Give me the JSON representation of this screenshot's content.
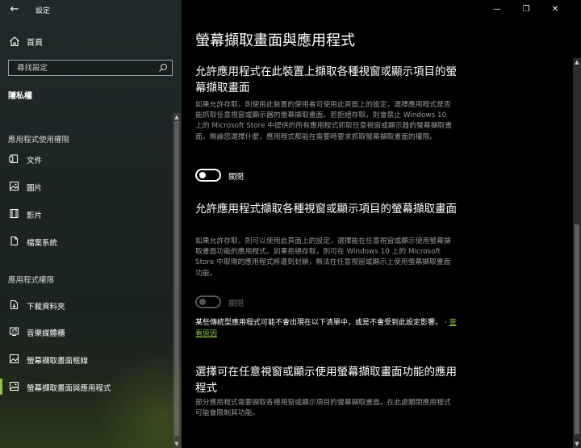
{
  "window": {
    "title": "設定",
    "back_glyph": "←",
    "minimize_glyph": "—",
    "restore_glyph": "❐",
    "close_glyph": "✕"
  },
  "sidebar": {
    "home_label": "首頁",
    "search_placeholder": "尋找設定",
    "privacy_heading": "隱私權",
    "group_app_permissions_top": "應用程式使用權限",
    "group_app_permissions": "應用程式權限",
    "items_top": [
      {
        "label": "文件",
        "icon": "document-icon"
      },
      {
        "label": "圖片",
        "icon": "image-icon"
      },
      {
        "label": "影片",
        "icon": "film-icon"
      },
      {
        "label": "檔案系統",
        "icon": "file-icon"
      }
    ],
    "items_bottom": [
      {
        "label": "下載資料夾",
        "icon": "download-folder-icon"
      },
      {
        "label": "音樂媒體櫃",
        "icon": "music-library-icon"
      },
      {
        "label": "螢幕擷取畫面框線",
        "icon": "screenshot-border-icon"
      },
      {
        "label": "螢幕擷取畫面與應用程式",
        "icon": "screenshot-app-icon",
        "active": true
      }
    ],
    "accent_color": "#8cc63e"
  },
  "main": {
    "page_title": "螢幕擷取畫面與應用程式",
    "section1": {
      "title": "允許應用程式在此裝置上擷取各種視窗或顯示項目的螢幕擷取畫面",
      "description": "如果允許存取，則使用此裝置的使用者可使用此頁面上的設定，選擇應用程式是否能抓取任意視窗或顯示器的螢幕擷取畫面。若拒絕存取，則會禁止 Windows 10 上的 Microsoft Store 中提供的所有應用程式抓取任意視窗或顯示器的螢幕擷取畫面。無論您選擇什麼，應用程式都能在需要時要求抓取螢幕擷取畫面的權限。",
      "toggle_label": "關閉",
      "toggle_on": false
    },
    "section2": {
      "title": "允許應用程式擷取各種視窗或顯示項目的螢幕擷取畫面",
      "description": "如果允許存取，則可以使用此頁面上的設定，選擇能在任意視窗或顯示使用螢幕擷取畫面功能的應用程式。如果拒絕存取，則可在 Windows 10 上的 Microsoft Store 中取得的應用程式將遭到封鎖，無法在任意視窗或顯示上使用螢幕擷取畫面功能。",
      "toggle_label": "關閉",
      "toggle_on": false,
      "toggle_disabled": true,
      "note": "某些傳統型應用程式可能不會出現在以下清單中，或是不會受到此設定影響。",
      "note_link": "查看原因"
    },
    "section3": {
      "title": "選擇可在任意視窗或顯示使用螢幕擷取畫面功能的應用程式",
      "description": "部分應用程式需要擷取各種視窗或顯示項目的螢幕擷取畫面。在此處關閉應用程式可能會限制其功能。"
    }
  }
}
